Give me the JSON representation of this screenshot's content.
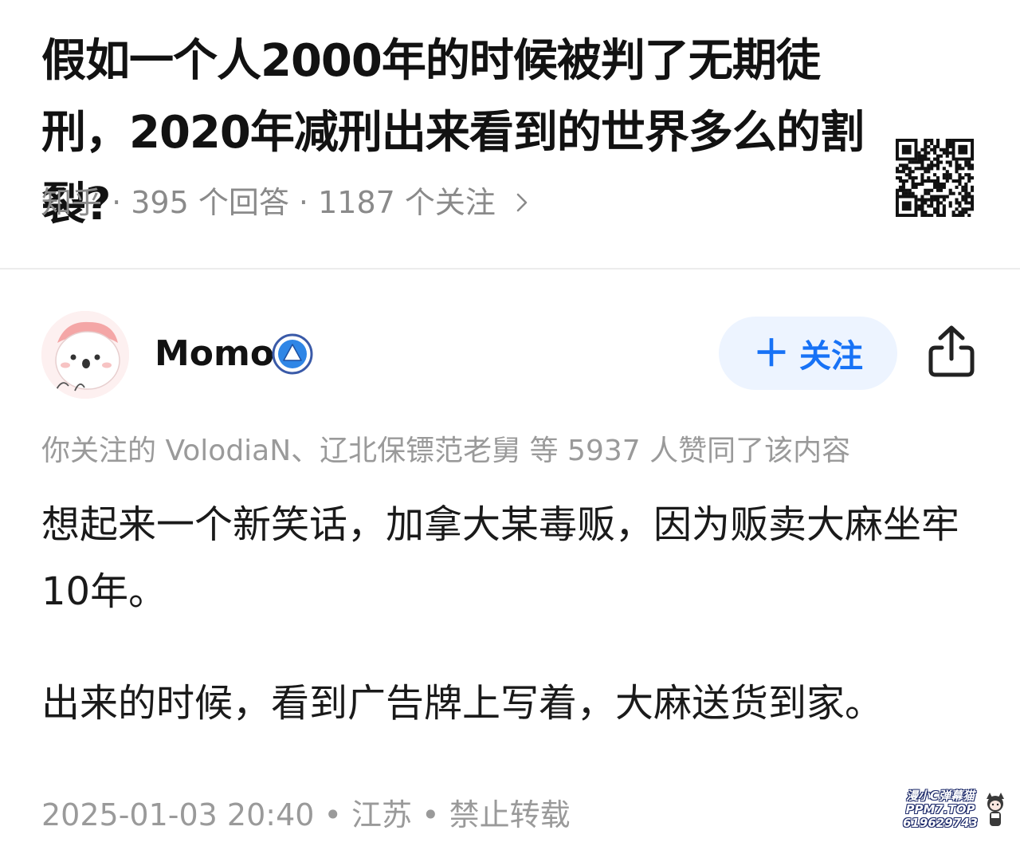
{
  "question": {
    "title": "假如一个人2000年的时候被判了无期徒刑，2020年减刑出来看到的世界多么的割裂?",
    "meta": "知乎 · 395 个回答 · 1187 个关注"
  },
  "answer": {
    "author": {
      "name": "Momo",
      "follow_label": "关注",
      "follow_icon": "plus-icon"
    },
    "upvote_text": "你关注的 VolodiaN、辽北保镖范老舅 等 5937 人赞同了该内容",
    "paragraphs": [
      "想起来一个新笑话，加拿大某毒贩，因为贩卖大麻坐牢10年。",
      "出来的时候，看到广告牌上写着，大麻送货到家。"
    ],
    "footer": "2025-01-03 20:40 • 江苏 • 禁止转载"
  },
  "watermark": {
    "lines": [
      "漫小C弹幕猫",
      "PPM7.TOP",
      "619629743"
    ]
  },
  "colors": {
    "accent": "#1772f6",
    "follow_bg": "#edf4ff",
    "muted_text": "#8a8a8a",
    "body_text": "#1a1a1a"
  }
}
